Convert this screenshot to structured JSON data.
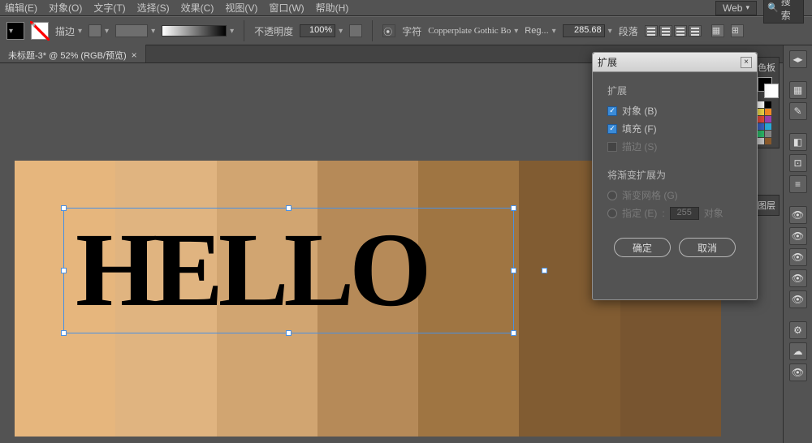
{
  "menu": {
    "items": [
      "编辑(E)",
      "对象(O)",
      "文字(T)",
      "选择(S)",
      "效果(C)",
      "视图(V)",
      "窗口(W)",
      "帮助(H)"
    ],
    "web_label": "Web",
    "search_placeholder": "搜索"
  },
  "options": {
    "stroke_label": "描边",
    "opacity_label": "不透明度",
    "opacity_value": "100%",
    "charset_label": "字符",
    "font_name": "Copperplate Gothic Bo",
    "font_style": "Reg...",
    "font_size": "285.68",
    "para_label": "段落"
  },
  "doc": {
    "tab_title": "未标题-3* @ 52% (RGB/预览)"
  },
  "canvas": {
    "text": "HELLO",
    "stripes": [
      "#e6b67d",
      "#e0b480",
      "#d1a571",
      "#b68a58",
      "#9f7542",
      "#815c32",
      "#785530"
    ]
  },
  "panels": {
    "swatches_title": "色板",
    "layers_title": "图层",
    "mini_colors": [
      "#ffffff",
      "#000000",
      "#f6e04b",
      "#f08a24",
      "#e84b3c",
      "#9b3fae",
      "#3a63c6",
      "#2aa8d8",
      "#2bbd6a",
      "#848484",
      "#cdcdcd",
      "#8b5a2b"
    ]
  },
  "dialog": {
    "title": "扩展",
    "sect1": "扩展",
    "object_label": "对象 (B)",
    "fill_label": "填充 (F)",
    "stroke_label": "描边 (S)",
    "sect2": "将渐变扩展为",
    "grad_mesh_label": "渐变网格 (G)",
    "specify_label": "指定 (E)",
    "specify_value": "255",
    "specify_suffix": "对象",
    "ok": "确定",
    "cancel": "取消"
  }
}
